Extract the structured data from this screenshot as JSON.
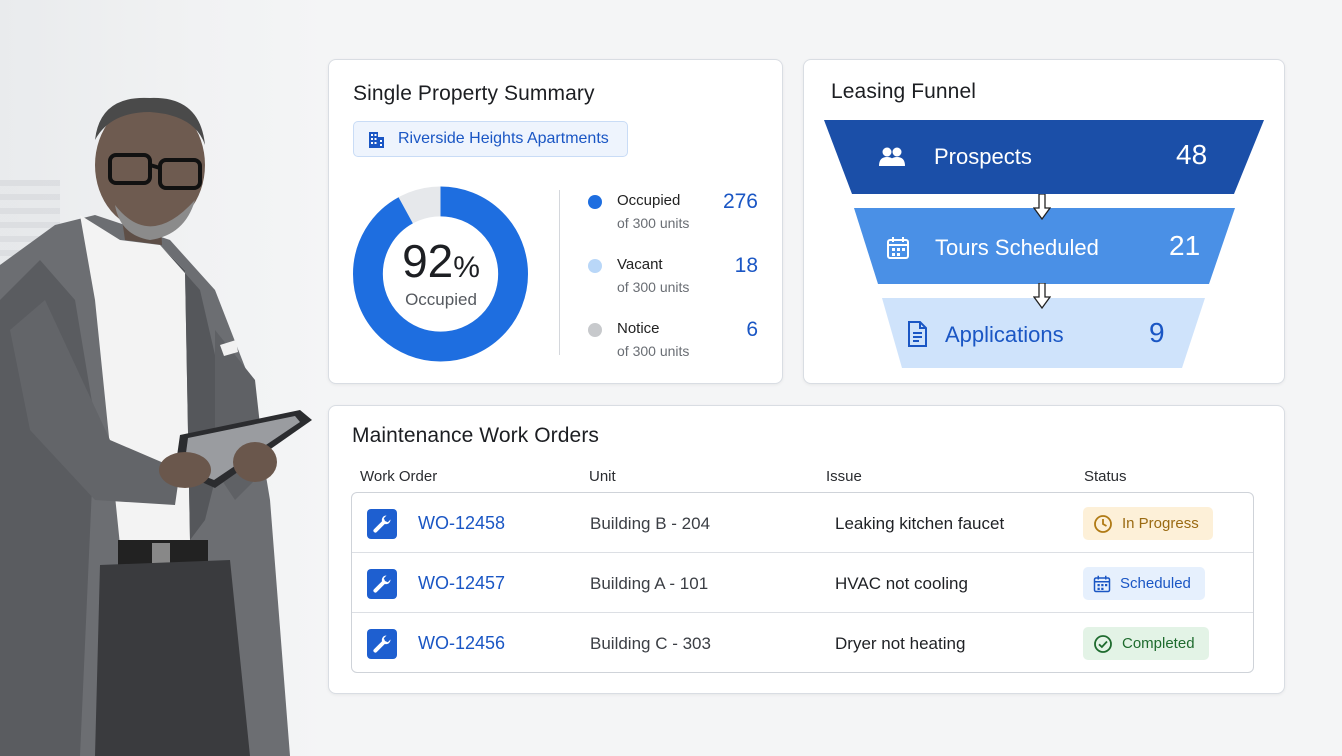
{
  "summary": {
    "title": "Single Property Summary",
    "property_name": "Riverside Heights Apartments",
    "occupancy_percent": "92",
    "percent_sign": "%",
    "occupancy_label": "Occupied",
    "occupancy_fraction": 0.92,
    "legend": [
      {
        "name": "Occupied",
        "sub": "of 300 units",
        "value": "276",
        "color": "#1e6ee0"
      },
      {
        "name": "Vacant",
        "sub": "of 300 units",
        "value": "18",
        "color": "#b9d7f8"
      },
      {
        "name": "Notice",
        "sub": "of 300 units",
        "value": "6",
        "color": "#c7c9cc"
      }
    ]
  },
  "funnel": {
    "title": "Leasing Funnel",
    "stages": [
      {
        "label": "Prospects",
        "value": "48",
        "icon": "people-icon",
        "color": "#1b4fa8"
      },
      {
        "label": "Tours Scheduled",
        "value": "21",
        "icon": "calendar-icon",
        "color": "#4a90e6"
      },
      {
        "label": "Applications",
        "value": "9",
        "icon": "document-icon",
        "color": "#cfe3fb"
      }
    ]
  },
  "maintenance": {
    "title": "Maintenance Work Orders",
    "headers": {
      "work_order": "Work Order",
      "unit": "Unit",
      "issue": "Issue",
      "status": "Status"
    },
    "rows": [
      {
        "id": "WO-12458",
        "unit": "Building B - 204",
        "issue": "Leaking kitchen faucet",
        "status": "In Progress",
        "status_icon": "clock-icon",
        "status_color": "#9a6a12",
        "status_bg": "#fdf0d8"
      },
      {
        "id": "WO-12457",
        "unit": "Building A - 101",
        "issue": "HVAC not cooling",
        "status": "Scheduled",
        "status_icon": "calendar-icon",
        "status_color": "#1a56c4",
        "status_bg": "#e6f0fd"
      },
      {
        "id": "WO-12456",
        "unit": "Building C - 303",
        "issue": "Dryer not heating",
        "status": "Completed",
        "status_icon": "check-circle-icon",
        "status_color": "#1e6b2e",
        "status_bg": "#e3f3e6"
      }
    ]
  }
}
